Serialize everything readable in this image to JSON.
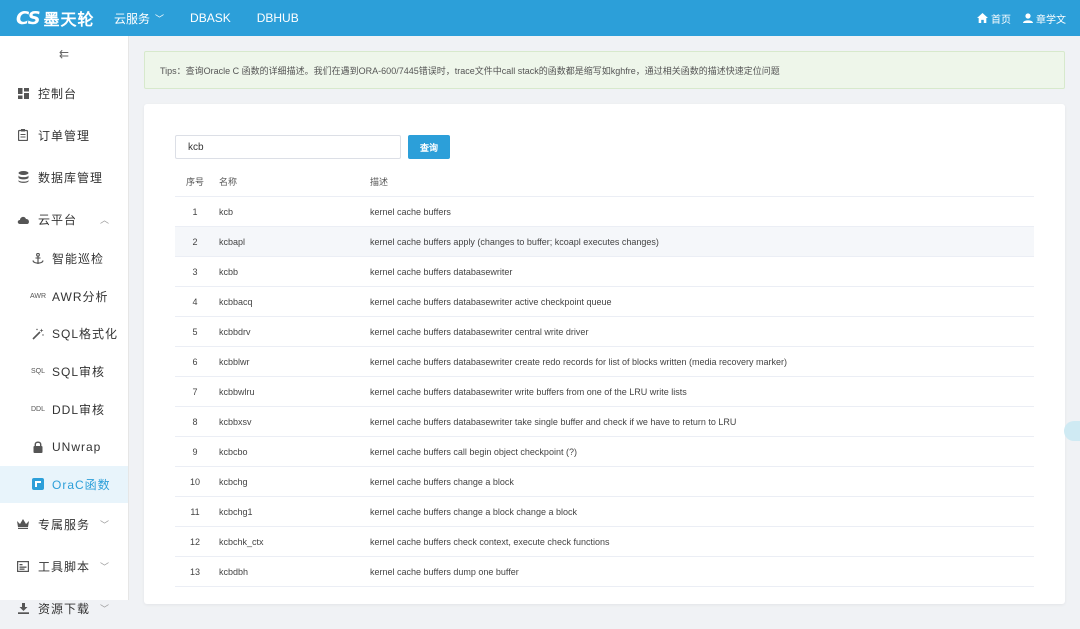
{
  "brand": {
    "logo": "CS",
    "name": "墨天轮"
  },
  "nav": {
    "cloud": "云服务",
    "dbask": "DBASK",
    "dbhub": "DBHUB"
  },
  "top_right": {
    "home": "首页",
    "user": "章学文"
  },
  "sidebar": {
    "collapse_icon": "⇇",
    "items": {
      "console": "控制台",
      "orders": "订单管理",
      "database": "数据库管理",
      "cloud_platform": "云平台",
      "exclusive": "专属服务",
      "tools": "工具脚本",
      "downloads": "资源下载"
    },
    "sub_items": [
      {
        "label": "智能巡检",
        "icon_text": "",
        "icon": "anchor-icon"
      },
      {
        "label": "AWR分析",
        "icon_text": "AWR",
        "icon": "awr-icon"
      },
      {
        "label": "SQL格式化",
        "icon_text": "",
        "icon": "magic-wand-icon"
      },
      {
        "label": "SQL审核",
        "icon_text": "SQL",
        "icon": "sql-icon"
      },
      {
        "label": "DDL审核",
        "icon_text": "DDL",
        "icon": "ddl-icon"
      },
      {
        "label": "UNwrap",
        "icon_text": "",
        "icon": "lock-icon"
      },
      {
        "label": "OraC函数",
        "icon_text": "",
        "icon": "function-icon",
        "active": true
      }
    ]
  },
  "tips": "Tips：查询Oracle C 函数的详细描述。我们在遇到ORA-600/7445错误时，trace文件中call stack的函数都是缩写如kghfre，通过相关函数的描述快速定位问题",
  "search": {
    "value": "kcb",
    "button": "查询"
  },
  "table": {
    "headers": {
      "no": "序号",
      "name": "名称",
      "desc": "描述"
    },
    "rows": [
      {
        "no": "1",
        "name": "kcb",
        "desc": "kernel cache buffers"
      },
      {
        "no": "2",
        "name": "kcbapl",
        "desc": "kernel cache buffers apply (changes to buffer; kcoapl executes changes)"
      },
      {
        "no": "3",
        "name": "kcbb",
        "desc": "kernel cache buffers databasewriter"
      },
      {
        "no": "4",
        "name": "kcbbacq",
        "desc": "kernel cache buffers databasewriter active checkpoint queue"
      },
      {
        "no": "5",
        "name": "kcbbdrv",
        "desc": "kernel cache buffers databasewriter central write driver"
      },
      {
        "no": "6",
        "name": "kcbblwr",
        "desc": "kernel cache buffers databasewriter create redo records for list of blocks written (media recovery marker)"
      },
      {
        "no": "7",
        "name": "kcbbwlru",
        "desc": "kernel cache buffers databasewriter write buffers from one of the LRU write lists"
      },
      {
        "no": "8",
        "name": "kcbbxsv",
        "desc": "kernel cache buffers databasewriter take single buffer and check if we have to return to LRU"
      },
      {
        "no": "9",
        "name": "kcbcbo",
        "desc": "kernel cache buffers call begin object checkpoint (?)"
      },
      {
        "no": "10",
        "name": "kcbchg",
        "desc": "kernel cache buffers change a block"
      },
      {
        "no": "11",
        "name": "kcbchg1",
        "desc": "kernel cache buffers change a block change a block"
      },
      {
        "no": "12",
        "name": "kcbchk_ctx",
        "desc": "kernel cache buffers check context, execute check functions"
      },
      {
        "no": "13",
        "name": "kcbdbh",
        "desc": "kernel cache buffers dump one buffer"
      }
    ]
  },
  "colors": {
    "primary": "#2c9fd9",
    "tips_bg": "#eef6ea",
    "active_bg": "#e8f4fb"
  }
}
